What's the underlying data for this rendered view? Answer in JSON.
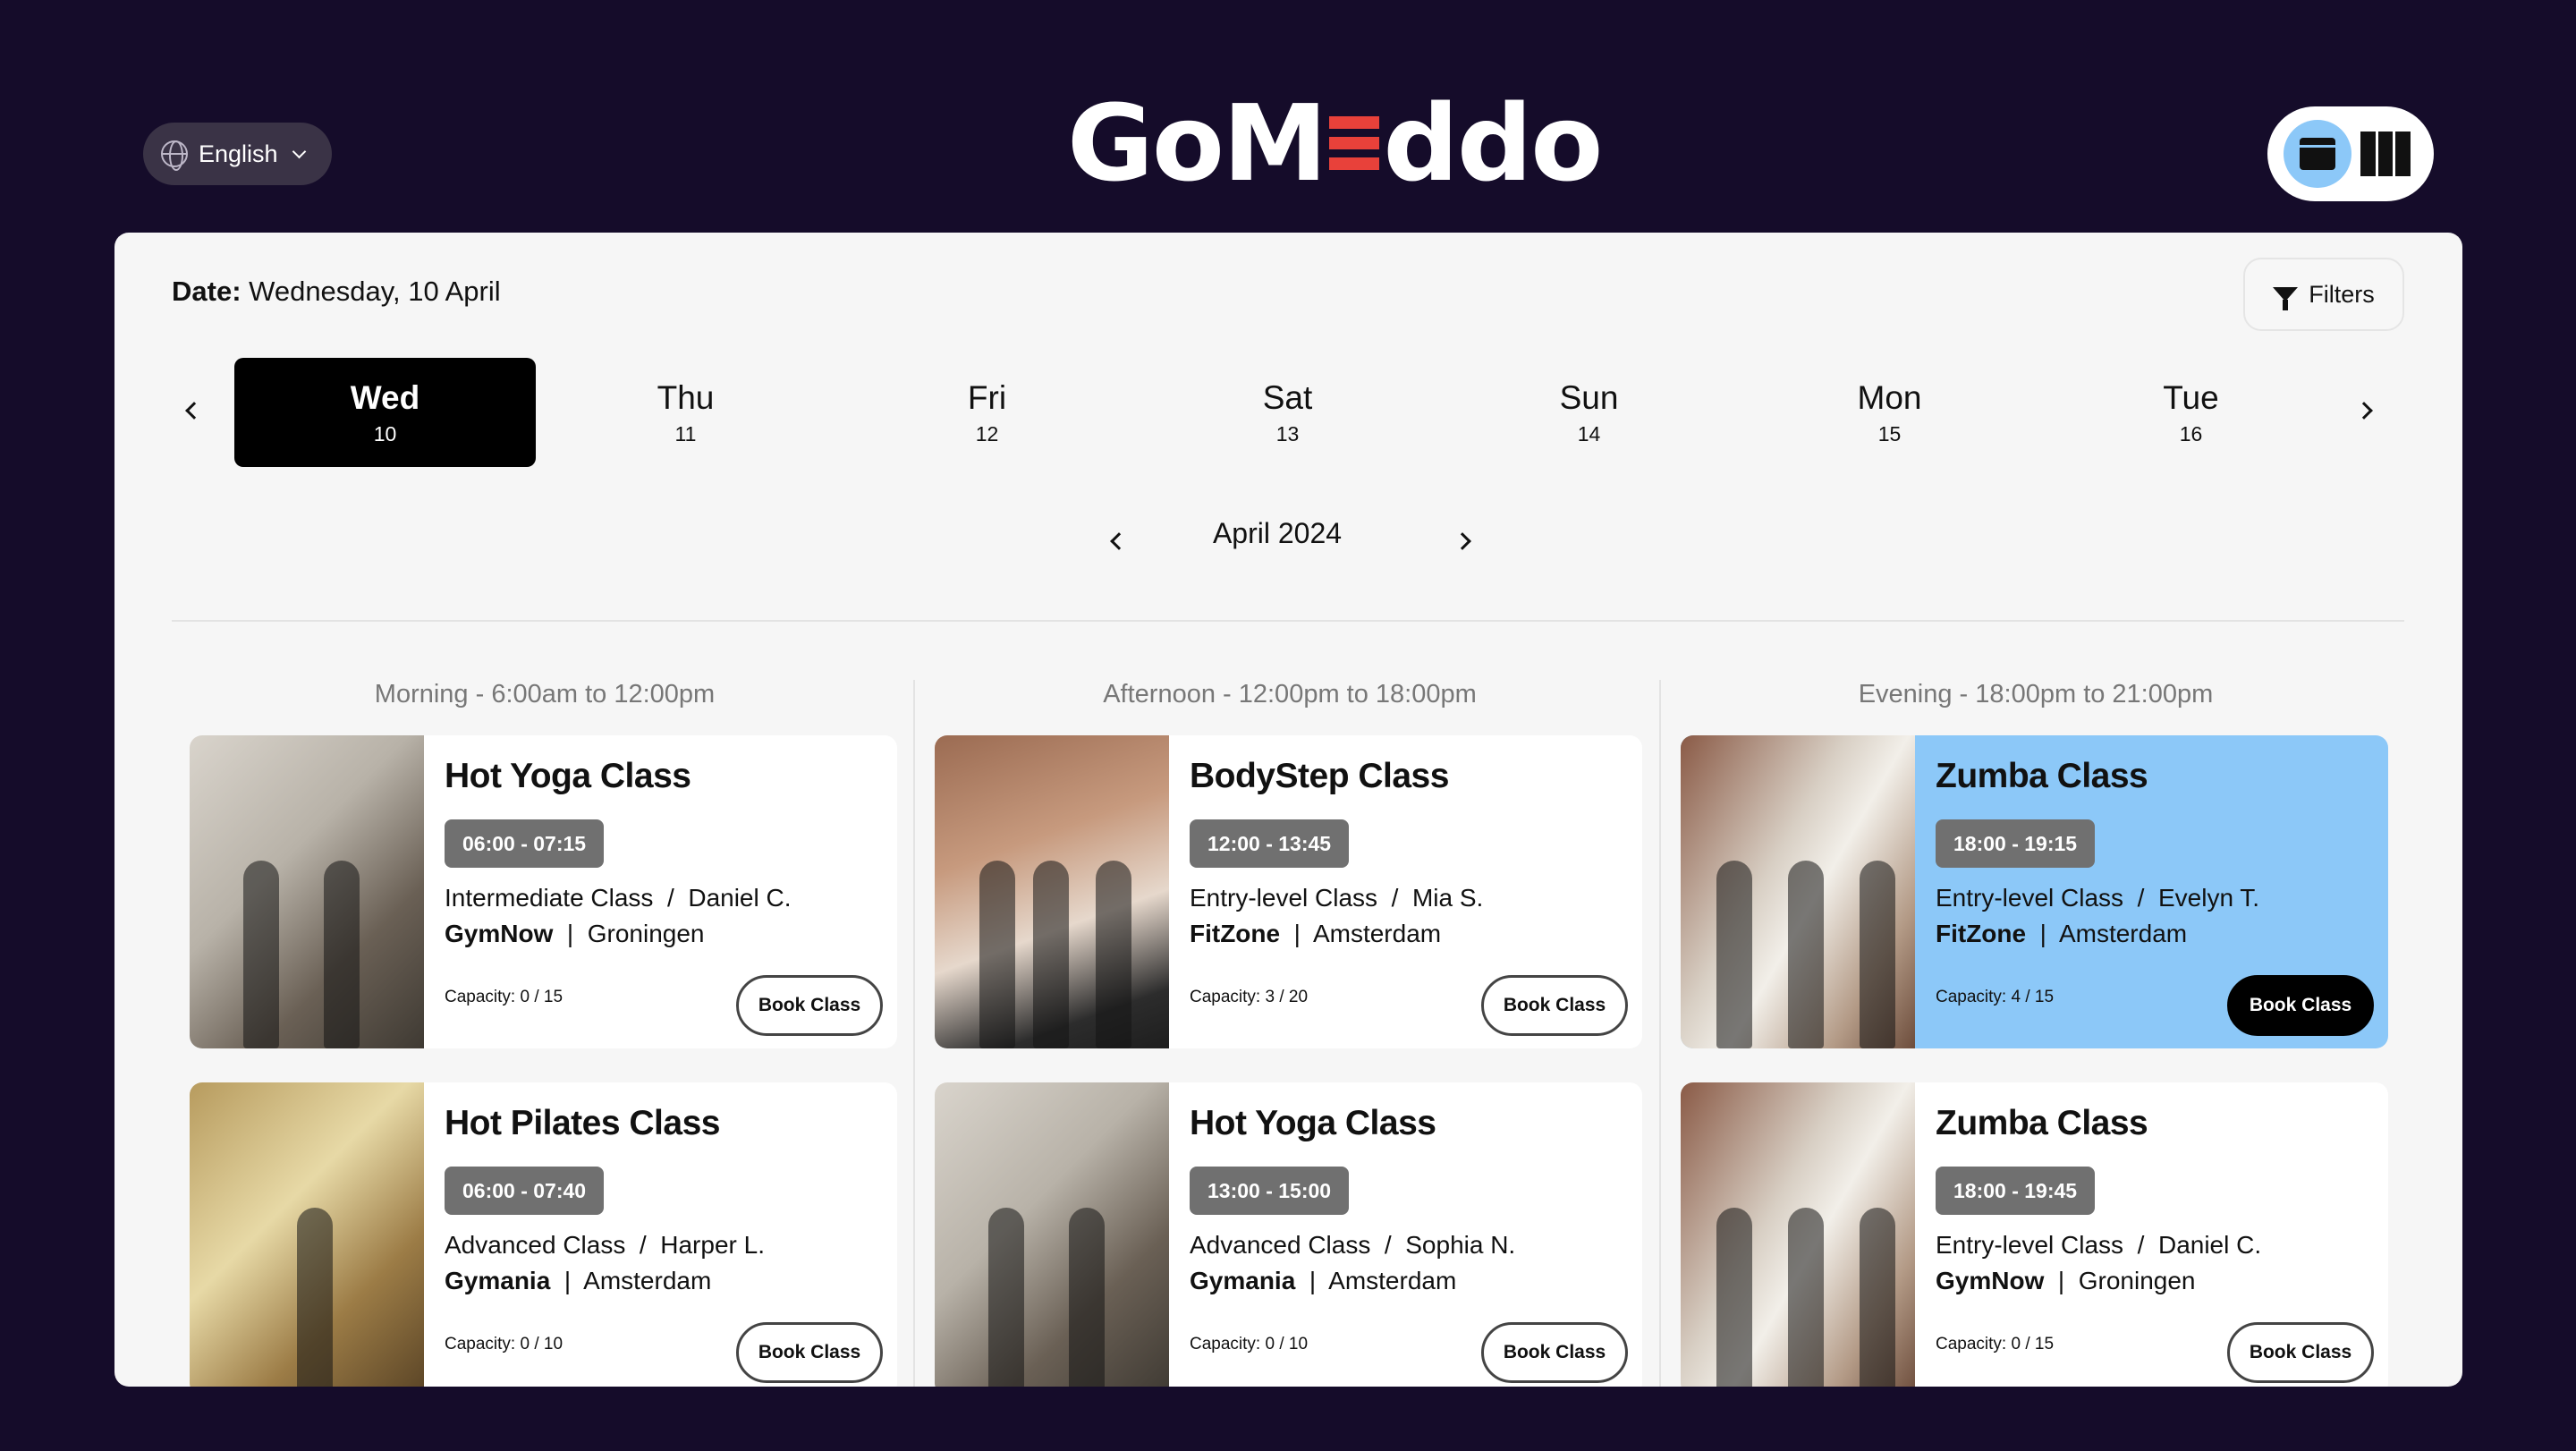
{
  "header": {
    "language": "English",
    "logo": "GoMeddo",
    "view_calendar_icon": "calendar-icon",
    "view_map_icon": "map-icon"
  },
  "date_bar": {
    "label": "Date:",
    "value": "Wednesday, 10 April",
    "filters_label": "Filters"
  },
  "days": [
    {
      "name": "Wed",
      "num": "10",
      "active": true
    },
    {
      "name": "Thu",
      "num": "11"
    },
    {
      "name": "Fri",
      "num": "12"
    },
    {
      "name": "Sat",
      "num": "13"
    },
    {
      "name": "Sun",
      "num": "14"
    },
    {
      "name": "Mon",
      "num": "15"
    },
    {
      "name": "Tue",
      "num": "16"
    }
  ],
  "month": "April 2024",
  "columns": [
    {
      "title": "Morning - 6:00am to 12:00pm",
      "cards": [
        {
          "title": "Hot Yoga Class",
          "time": "06:00 - 07:15",
          "level": "Intermediate Class",
          "instructor": "Daniel C.",
          "gym": "GymNow",
          "city": "Groningen",
          "capacity": "Capacity: 0 / 15",
          "book": "Book Class"
        },
        {
          "title": "Hot Pilates Class",
          "time": "06:00 - 07:40",
          "level": "Advanced Class",
          "instructor": "Harper L.",
          "gym": "Gymania",
          "city": "Amsterdam",
          "capacity": "Capacity: 0 / 10",
          "book": "Book Class"
        }
      ]
    },
    {
      "title": "Afternoon - 12:00pm to 18:00pm",
      "cards": [
        {
          "title": "BodyStep Class",
          "time": "12:00 - 13:45",
          "level": "Entry-level Class",
          "instructor": "Mia S.",
          "gym": "FitZone",
          "city": "Amsterdam",
          "capacity": "Capacity: 3 / 20",
          "book": "Book Class"
        },
        {
          "title": "Hot Yoga Class",
          "time": "13:00 - 15:00",
          "level": "Advanced Class",
          "instructor": "Sophia N.",
          "gym": "Gymania",
          "city": "Amsterdam",
          "capacity": "Capacity: 0 / 10",
          "book": "Book Class"
        }
      ]
    },
    {
      "title": "Evening - 18:00pm to 21:00pm",
      "cards": [
        {
          "title": "Zumba Class",
          "time": "18:00 - 19:15",
          "level": "Entry-level Class",
          "instructor": "Evelyn T.",
          "gym": "FitZone",
          "city": "Amsterdam",
          "capacity": "Capacity: 4 / 15",
          "book": "Book Class",
          "highlight": "#8cc8f8"
        },
        {
          "title": "Zumba Class",
          "time": "18:00 - 19:45",
          "level": "Entry-level Class",
          "instructor": "Daniel C.",
          "gym": "GymNow",
          "city": "Groningen",
          "capacity": "Capacity: 0 / 15",
          "book": "Book Class"
        }
      ]
    }
  ]
}
